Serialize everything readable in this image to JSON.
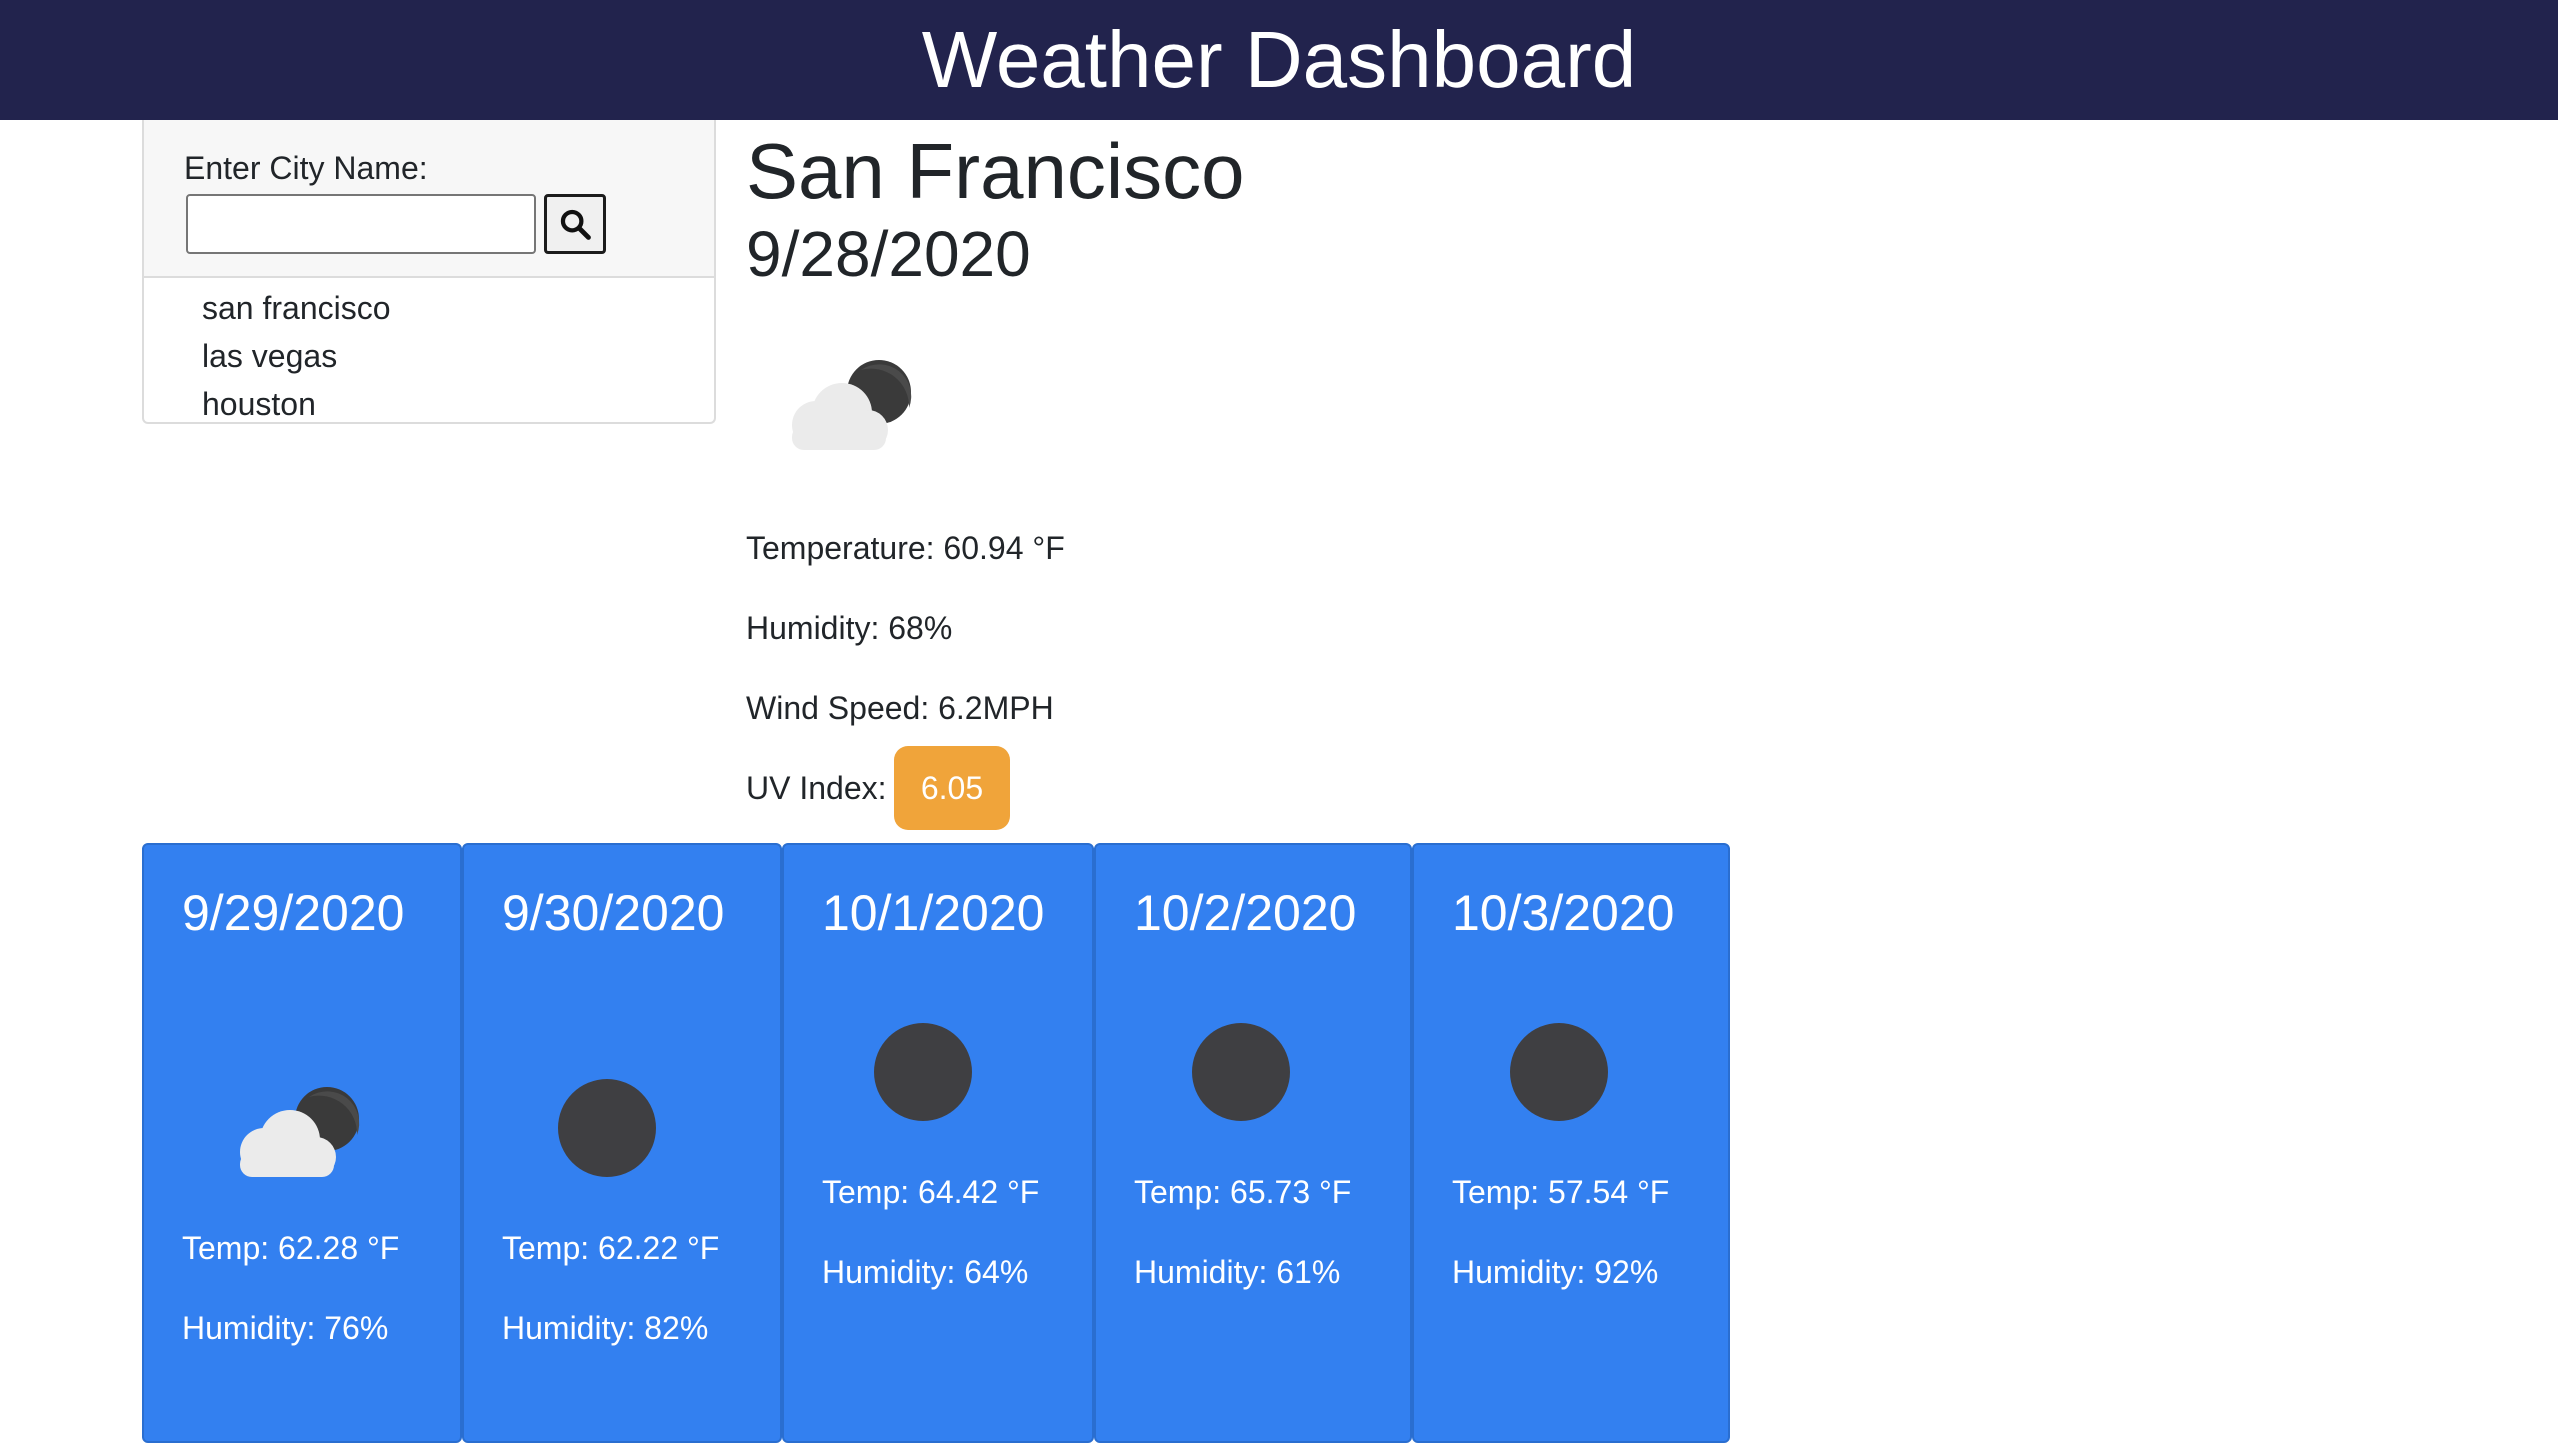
{
  "header": {
    "title": "Weather Dashboard"
  },
  "search": {
    "label": "Enter City Name:",
    "input_value": "",
    "placeholder": "",
    "button_icon": "search-icon"
  },
  "history": [
    "san francisco",
    "las vegas",
    "houston"
  ],
  "current": {
    "city": "San Francisco",
    "date": "9/28/2020",
    "icon": "partly-cloudy-night-icon",
    "temperature": "Temperature: 60.94 °F",
    "humidity": "Humidity: 68%",
    "wind": "Wind Speed: 6.2MPH",
    "uv_label": "UV Index:",
    "uv_value": "6.05"
  },
  "forecast": [
    {
      "date": "9/29/2020",
      "icon": "partly-cloudy-night-icon",
      "temp": "Temp: 62.28 °F",
      "humidity": "Humidity: 76%"
    },
    {
      "date": "9/30/2020",
      "icon": "clear-night-icon",
      "temp": "Temp: 62.22 °F",
      "humidity": "Humidity: 82%"
    },
    {
      "date": "10/1/2020",
      "icon": "clear-night-icon",
      "temp": "Temp: 64.42 °F",
      "humidity": "Humidity: 64%"
    },
    {
      "date": "10/2/2020",
      "icon": "clear-night-icon",
      "temp": "Temp: 65.73 °F",
      "humidity": "Humidity: 61%"
    },
    {
      "date": "10/3/2020",
      "icon": "clear-night-icon",
      "temp": "Temp: 57.54 °F",
      "humidity": "Humidity: 92%"
    }
  ],
  "colors": {
    "header_bg": "#22234d",
    "card_bg": "#3380f0",
    "uv_badge": "#f0a43a"
  }
}
